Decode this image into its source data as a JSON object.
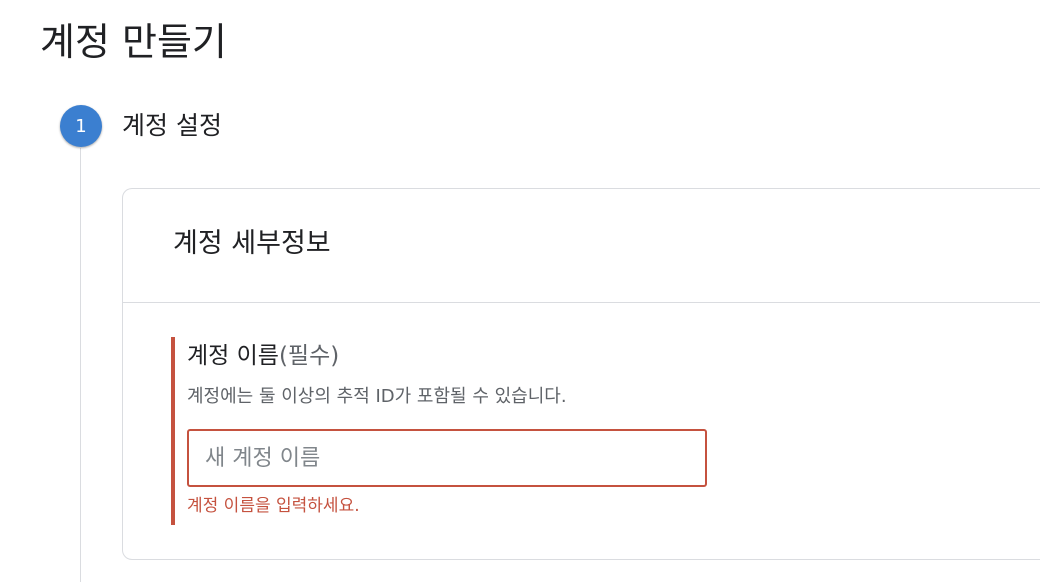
{
  "page": {
    "title": "계정 만들기"
  },
  "stepper": {
    "step_number": "1",
    "step_title": "계정 설정",
    "step_color": "#3b7fd0"
  },
  "card": {
    "title": "계정 세부정보",
    "field": {
      "label": "계정 이름",
      "required_suffix": "(필수)",
      "help_text": "계정에는 둘 이상의 추적 ID가 포함될 수 있습니다.",
      "input_value": "",
      "input_placeholder": "새 계정 이름",
      "error_text": "계정 이름을 입력하세요.",
      "error_color": "#c5523f"
    }
  }
}
